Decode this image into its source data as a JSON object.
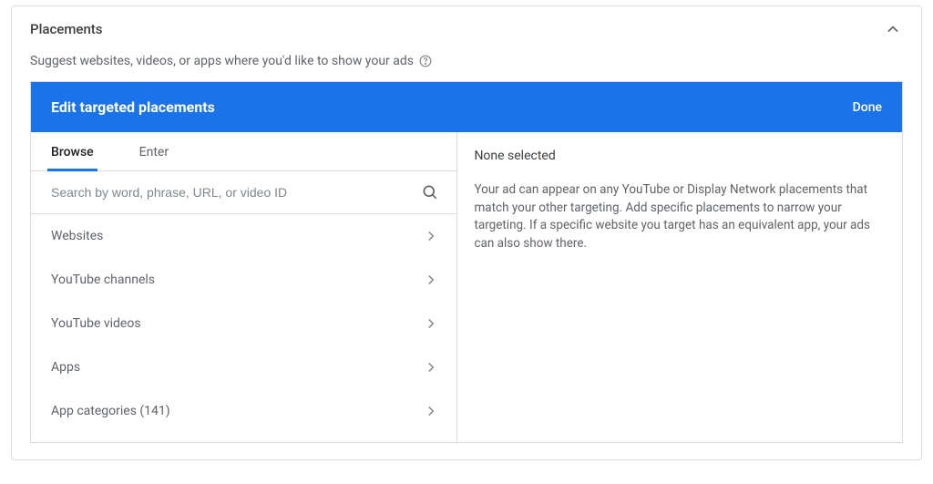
{
  "header": {
    "title": "Placements"
  },
  "subheader": {
    "text": "Suggest websites, videos, or apps where you'd like to show your ads"
  },
  "panel": {
    "title": "Edit targeted placements",
    "done_label": "Done"
  },
  "tabs": {
    "browse": "Browse",
    "enter": "Enter"
  },
  "search": {
    "placeholder": "Search by word, phrase, URL, or video ID"
  },
  "categories": {
    "websites": "Websites",
    "youtube_channels": "YouTube channels",
    "youtube_videos": "YouTube videos",
    "apps": "Apps",
    "app_categories": "App categories (141)"
  },
  "right": {
    "selected_title": "None selected",
    "description": "Your ad can appear on any YouTube or Display Network placements that match your other targeting. Add specific placements to narrow your targeting. If a specific website you target has an equivalent app, your ads can also show there."
  }
}
